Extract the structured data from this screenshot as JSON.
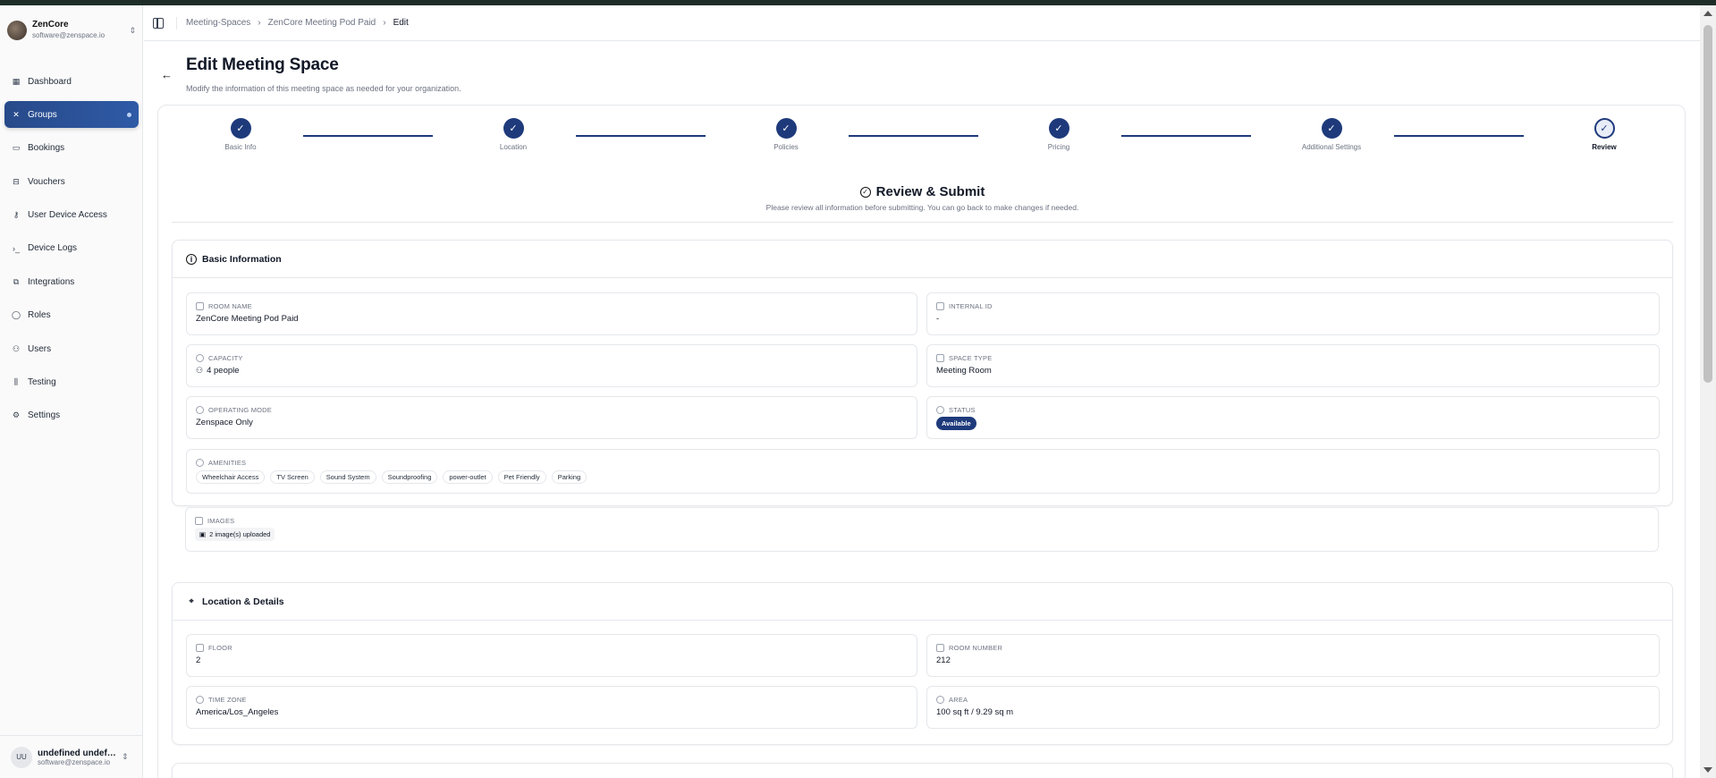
{
  "org": {
    "name": "ZenCore",
    "email": "software@zenspace.io"
  },
  "nav": [
    {
      "label": "Dashboard",
      "icon": "dashboard-icon",
      "glyph": "▦",
      "active": false
    },
    {
      "label": "Groups",
      "icon": "groups-icon",
      "glyph": "✕",
      "active": true
    },
    {
      "label": "Bookings",
      "icon": "bookings-icon",
      "glyph": "▭",
      "active": false
    },
    {
      "label": "Vouchers",
      "icon": "vouchers-icon",
      "glyph": "⊟",
      "active": false
    },
    {
      "label": "User Device Access",
      "icon": "key-icon",
      "glyph": "⚷",
      "active": false
    },
    {
      "label": "Device Logs",
      "icon": "terminal-icon",
      "glyph": "›_",
      "active": false
    },
    {
      "label": "Integrations",
      "icon": "integrations-icon",
      "glyph": "⧉",
      "active": false
    },
    {
      "label": "Roles",
      "icon": "shield-icon",
      "glyph": "◯",
      "active": false
    },
    {
      "label": "Users",
      "icon": "users-icon",
      "glyph": "⚇",
      "active": false
    },
    {
      "label": "Testing",
      "icon": "flask-icon",
      "glyph": "⫼",
      "active": false
    },
    {
      "label": "Settings",
      "icon": "gear-icon",
      "glyph": "⚙",
      "active": false
    }
  ],
  "user": {
    "initials": "UU",
    "name": "undefined undefin...",
    "email": "software@zenspace.io"
  },
  "breadcrumb": [
    "Meeting-Spaces",
    "ZenCore Meeting Pod Paid",
    "Edit"
  ],
  "page": {
    "title": "Edit Meeting Space",
    "subtitle": "Modify the information of this meeting space as needed for your organization."
  },
  "steps": [
    {
      "label": "Basic Info",
      "done": true
    },
    {
      "label": "Location",
      "done": true
    },
    {
      "label": "Policies",
      "done": true
    },
    {
      "label": "Pricing",
      "done": true
    },
    {
      "label": "Additional Settings",
      "done": true
    },
    {
      "label": "Review",
      "done": false,
      "current": true
    }
  ],
  "review": {
    "title": "Review & Submit",
    "subtitle": "Please review all information before submitting. You can go back to make changes if needed."
  },
  "basic_info": {
    "title": "Basic Information",
    "room_name_label": "ROOM NAME",
    "room_name": "ZenCore Meeting Pod Paid",
    "internal_id_label": "INTERNAL ID",
    "internal_id": "-",
    "capacity_label": "CAPACITY",
    "capacity": "4 people",
    "space_type_label": "SPACE TYPE",
    "space_type": "Meeting Room",
    "operating_mode_label": "OPERATING MODE",
    "operating_mode": "Zenspace Only",
    "status_label": "STATUS",
    "status": "Available",
    "amenities_label": "AMENITIES",
    "amenities": [
      "Wheelchair Access",
      "TV Screen",
      "Sound System",
      "Soundproofing",
      "power-outlet",
      "Pet Friendly",
      "Parking"
    ],
    "images_label": "IMAGES",
    "images": "2 image(s) uploaded"
  },
  "location": {
    "title": "Location & Details",
    "floor_label": "FLOOR",
    "floor": "2",
    "room_number_label": "ROOM NUMBER",
    "room_number": "212",
    "time_zone_label": "TIME ZONE",
    "time_zone": "America/Los_Angeles",
    "area_label": "AREA",
    "area": "100 sq ft / 9.29 sq m"
  },
  "colors": {
    "accent": "#1e3a7b",
    "sidebar_active": "#2f5aa6"
  }
}
